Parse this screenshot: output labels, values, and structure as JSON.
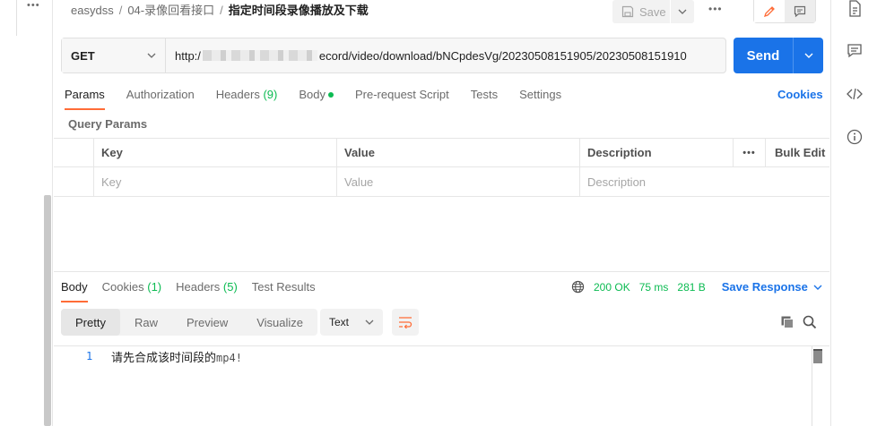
{
  "breadcrumb": {
    "collection": "easydss",
    "folder": "04-录像回看接口",
    "request": "指定时间段录像播放及下载"
  },
  "header": {
    "save_label": "Save"
  },
  "request": {
    "method": "GET",
    "url_prefix": "http:/",
    "url_suffix": "ecord/video/download/bNCpdesVg/20230508151905/20230508151910",
    "send_label": "Send"
  },
  "request_tabs": [
    {
      "label": "Params",
      "active": true
    },
    {
      "label": "Authorization"
    },
    {
      "label": "Headers",
      "count": "(9)"
    },
    {
      "label": "Body",
      "has_dot": true
    },
    {
      "label": "Pre-request Script"
    },
    {
      "label": "Tests"
    },
    {
      "label": "Settings"
    }
  ],
  "cookies_label": "Cookies",
  "query_params": {
    "title": "Query Params",
    "headers": {
      "key": "Key",
      "value": "Value",
      "description": "Description",
      "bulk_edit": "Bulk Edit"
    },
    "placeholders": {
      "key": "Key",
      "value": "Value",
      "description": "Description"
    }
  },
  "response": {
    "tabs": [
      {
        "label": "Body",
        "active": true
      },
      {
        "label": "Cookies",
        "count": "(1)"
      },
      {
        "label": "Headers",
        "count": "(5)"
      },
      {
        "label": "Test Results"
      }
    ],
    "status": "200 OK",
    "time": "75 ms",
    "size": "281 B",
    "save_response_label": "Save Response",
    "formats": [
      "Pretty",
      "Raw",
      "Preview",
      "Visualize"
    ],
    "active_format": "Pretty",
    "type": "Text",
    "line_number": "1",
    "body_text": "请先合成该时间段的",
    "body_mono": "mp4!"
  },
  "colors": {
    "accent": "#1a73e8",
    "success": "#0cbb52",
    "tab_underline": "#ff6c37"
  }
}
